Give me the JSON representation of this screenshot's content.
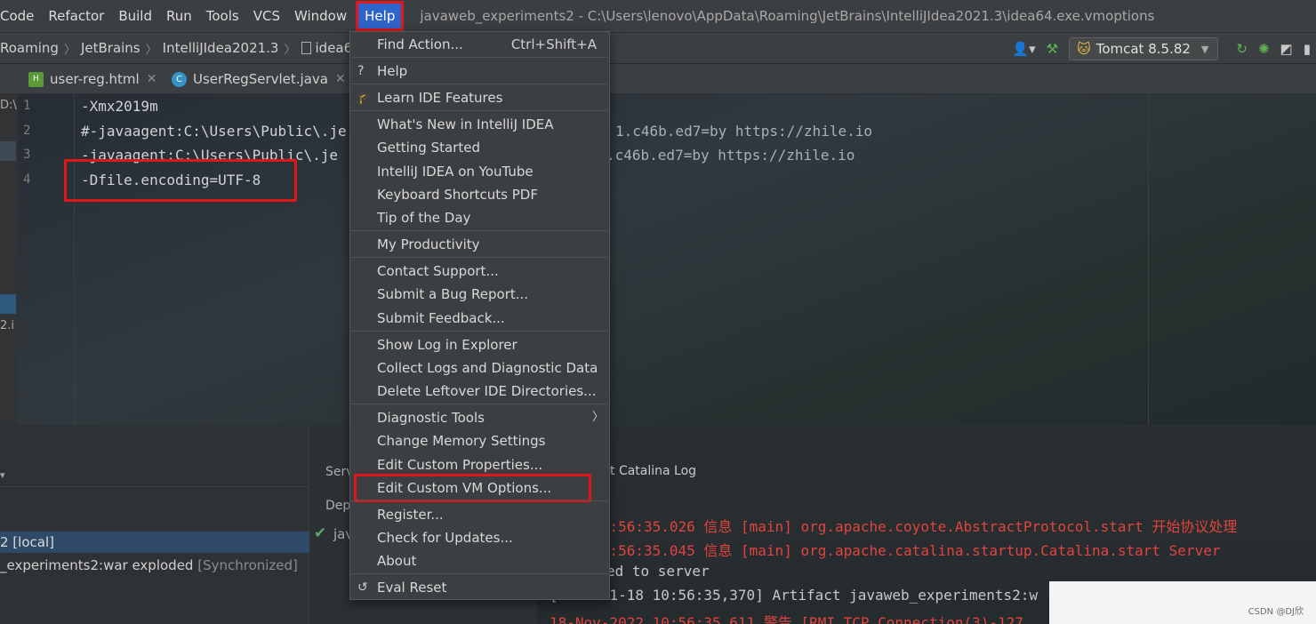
{
  "menubar": {
    "items": [
      "Code",
      "Refactor",
      "Build",
      "Run",
      "Tools",
      "VCS",
      "Window"
    ],
    "help_label": "Help",
    "window_title": "javaweb_experiments2 - C:\\Users\\lenovo\\AppData\\Roaming\\JetBrains\\IntelliJIdea2021.3\\idea64.exe.vmoptions"
  },
  "breadcrumb": {
    "items": [
      "Roaming",
      "JetBrains",
      "IntelliJIdea2021.3",
      "idea64.e"
    ]
  },
  "toolbar": {
    "run_config": "Tomcat 8.5.82"
  },
  "tabs": [
    {
      "label": "user-reg.html"
    },
    {
      "label": "UserRegServlet.java"
    }
  ],
  "editor": {
    "left_clip": [
      "D:\\",
      "2.i"
    ],
    "line_numbers": [
      "1",
      "2",
      "3",
      "4"
    ],
    "lines": [
      {
        "left": "-Xmx2019m",
        "right": ""
      },
      {
        "left": "#-javaagent:C:\\Users\\Public\\.je",
        "right": "1.c46b.ed7=by https://zhile.io"
      },
      {
        "left": "-javaagent:C:\\Users\\Public\\.je",
        "right": ".c46b.ed7=by https://zhile.io"
      },
      {
        "left": "-Dfile.encoding=UTF-8",
        "right": ""
      }
    ]
  },
  "help_menu": {
    "items": [
      {
        "label": "Find Action...",
        "shortcut": "Ctrl+Shift+A"
      },
      {
        "label": "Help",
        "icon": "question-icon"
      },
      {
        "label": "Learn IDE Features",
        "icon": "graduation-cap-icon"
      },
      {
        "label": "What's New in IntelliJ IDEA"
      },
      {
        "label": "Getting Started"
      },
      {
        "label": "IntelliJ IDEA on YouTube"
      },
      {
        "label": "Keyboard Shortcuts PDF"
      },
      {
        "label": "Tip of the Day"
      },
      {
        "label": "My Productivity"
      },
      {
        "label": "Contact Support..."
      },
      {
        "label": "Submit a Bug Report..."
      },
      {
        "label": "Submit Feedback..."
      },
      {
        "label": "Show Log in Explorer"
      },
      {
        "label": "Collect Logs and Diagnostic Data"
      },
      {
        "label": "Delete Leftover IDE Directories..."
      },
      {
        "label": "Diagnostic Tools",
        "submenu": true
      },
      {
        "label": "Change Memory Settings"
      },
      {
        "label": "Edit Custom Properties..."
      },
      {
        "label": "Edit Custom VM Options..."
      },
      {
        "label": "Register..."
      },
      {
        "label": "Check for Updates..."
      },
      {
        "label": "About"
      },
      {
        "label": "Eval Reset",
        "icon": "undo-icon"
      }
    ]
  },
  "services": {
    "server_label": "2 [local]",
    "artifact_label": "_experiments2:war exploded",
    "artifact_status": "[Synchronized]",
    "tab_server": "Serv",
    "tab_deploy": "Depl",
    "deploy_item": "jav"
  },
  "log": {
    "tab_label": "t Catalina Log",
    "lines": [
      {
        "text": "2022 10:56:35.026 信息 [main] org.apache.coyote.AbstractProtocol.start 开始协议处理",
        "color": "red"
      },
      {
        "text": "2022 10:56:35.045 信息 [main] org.apache.catalina.startup.Catalina.start Server",
        "color": "red"
      },
      {
        "text": "ed to server",
        "color": "plain"
      },
      {
        "text": "[2022-11-18 10:56:35,370] Artifact javaweb_experiments2:w",
        "color": "plain"
      },
      {
        "text": "18-Nov-2022 10:56:35.611 警告 [RMI TCP Connection(3)-127.",
        "color": "red"
      }
    ]
  },
  "watermark": "CSDN @DJ欣",
  "colors": {
    "highlight_red": "#e0161a",
    "menu_bg": "#3c3f41",
    "selection_blue": "#2f65ca",
    "log_red": "#e0443e"
  }
}
